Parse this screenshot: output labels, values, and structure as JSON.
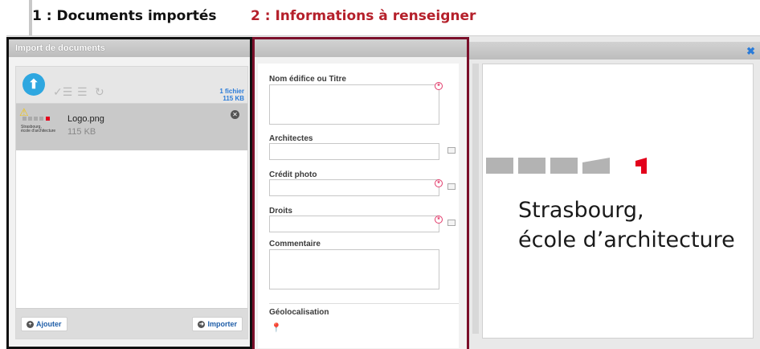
{
  "annotations": {
    "label_1": "1 : Documents importés",
    "label_2": "2 : Informations à renseigner"
  },
  "upload_panel": {
    "title": "Import de documents",
    "file_count": "1 fichier",
    "total_size": "115 KB",
    "files": [
      {
        "name": "Logo.png",
        "size": "115 KB",
        "status": "warning"
      }
    ],
    "add_button": "Ajouter",
    "import_button": "Importer"
  },
  "form": {
    "fields": [
      {
        "label": "Nom édifice ou Titre",
        "required": true
      },
      {
        "label": "Architectes",
        "required": false
      },
      {
        "label": "Crédit photo",
        "required": true
      },
      {
        "label": "Droits",
        "required": true
      },
      {
        "label": "Commentaire",
        "required": false
      },
      {
        "label": "Géolocalisation",
        "required": false
      }
    ]
  },
  "preview": {
    "logo_line1": "Strasbourg,",
    "logo_line2": "école d’architecture",
    "thumb_line1": "Strasbourg,",
    "thumb_line2": "école d'architecture",
    "accent_color": "#e3001b"
  },
  "icons": [
    "upload-icon",
    "check-list-icon",
    "list-icon",
    "refresh-icon",
    "warning-icon",
    "remove-icon",
    "add-icon",
    "import-icon",
    "required-icon",
    "book-icon",
    "map-pin-icon",
    "close-icon"
  ]
}
